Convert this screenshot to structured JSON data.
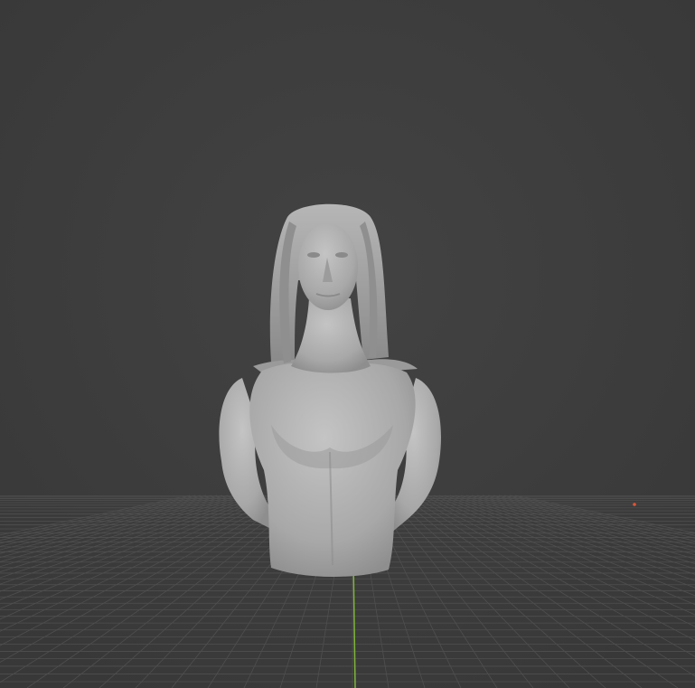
{
  "viewport": {
    "kind": "3d-viewport",
    "background": "#3d3d3d",
    "grid_color": "#4f4f4f",
    "y_axis_color": "#7fb53a",
    "origin_marker_color": "#d9573a"
  },
  "model": {
    "name": "sculpted-bust",
    "material_color": "#a9a9a9"
  }
}
